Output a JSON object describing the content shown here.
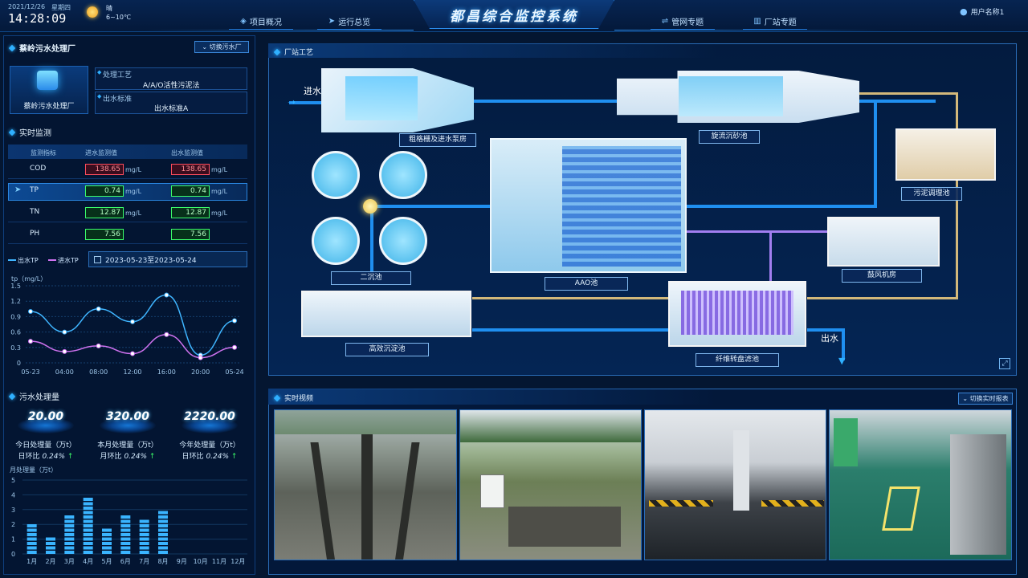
{
  "header": {
    "date": "2021/12/26",
    "weekday": "星期四",
    "time": "14:28:09",
    "weather": "晴",
    "temperature": "6~10℃",
    "title": "都昌综合监控系统",
    "nav": [
      "项目概况",
      "运行总览",
      "管网专题",
      "厂站专题"
    ],
    "user": "用户名称1"
  },
  "plant": {
    "name": "蔡岭污水处理厂",
    "switch_label": "切换污水厂",
    "icon_label": "蔡岭污水处理厂",
    "process_label": "处理工艺",
    "process_value": "A/A/O活性污泥法",
    "standard_label": "出水标准",
    "standard_value": "出水标准A"
  },
  "realtime": {
    "title": "实时监测",
    "header": [
      "监测指标",
      "进水监测值",
      "出水监测值"
    ],
    "rows": [
      {
        "name": "COD",
        "in": "138.65",
        "out": "138.65",
        "unit": "mg/L",
        "in_status": "red",
        "out_status": "red"
      },
      {
        "name": "TP",
        "in": "0.74",
        "out": "0.74",
        "unit": "mg/L",
        "in_status": "green",
        "out_status": "green"
      },
      {
        "name": "TN",
        "in": "12.87",
        "out": "12.87",
        "unit": "mg/L",
        "in_status": "green",
        "out_status": "green"
      },
      {
        "name": "PH",
        "in": "7.56",
        "out": "7.56",
        "unit": "",
        "in_status": "green",
        "out_status": "green"
      }
    ]
  },
  "trend": {
    "legend_out": "出水TP",
    "legend_in": "进水TP",
    "date_range": "2023-05-23至2023-05-24",
    "unit_label": "tp（mg/L）",
    "chart_data": {
      "type": "line",
      "x": [
        "05-23",
        "04:00",
        "08:00",
        "12:00",
        "16:00",
        "20:00",
        "05-24"
      ],
      "ylim": [
        0,
        1.5
      ],
      "yticks": [
        "1.5",
        "1.2",
        "0.9",
        "0.6",
        "0.3",
        "0"
      ],
      "series": [
        {
          "name": "出水TP",
          "color": "#3fb5ff",
          "values": [
            1.0,
            0.6,
            1.05,
            0.8,
            1.32,
            0.15,
            0.82
          ]
        },
        {
          "name": "进水TP",
          "color": "#d072f0",
          "values": [
            0.42,
            0.22,
            0.33,
            0.18,
            0.55,
            0.1,
            0.3
          ]
        }
      ]
    }
  },
  "treatment": {
    "title": "污水处理量",
    "stats": [
      {
        "value": "20.00",
        "label": "今日处理量（万t）",
        "ratio_label": "日环比",
        "ratio": "0.24%"
      },
      {
        "value": "320.00",
        "label": "本月处理量（万t）",
        "ratio_label": "月环比",
        "ratio": "0.24%"
      },
      {
        "value": "2220.00",
        "label": "今年处理量（万t）",
        "ratio_label": "日环比",
        "ratio": "0.24%"
      }
    ],
    "monthly_label": "月处理量（万t）",
    "chart_data": {
      "type": "bar",
      "categories": [
        "1月",
        "2月",
        "3月",
        "4月",
        "5月",
        "6月",
        "7月",
        "8月",
        "9月",
        "10月",
        "11月",
        "12月"
      ],
      "values": [
        2.1,
        1.4,
        2.9,
        3.8,
        1.9,
        2.7,
        2.5,
        3.2,
        0,
        0,
        0,
        0
      ],
      "ylim": [
        0,
        5
      ],
      "yticks": [
        "5",
        "4",
        "3",
        "2",
        "1",
        "0"
      ]
    }
  },
  "process": {
    "title": "厂站工艺",
    "inlet": "进水",
    "outlet": "出水",
    "units": [
      "粗格栅及进水泵房",
      "旋流沉砂池",
      "污泥调理池",
      "AAO池",
      "鼓风机房",
      "二沉池",
      "高效沉淀池",
      "纤维转盘滤池"
    ]
  },
  "video": {
    "title": "实时视频",
    "switch_label": "切换实时报表"
  },
  "colors": {
    "accent": "#2fb0ff",
    "alarm": "#ff4d5e",
    "normal": "#3cff6a"
  }
}
